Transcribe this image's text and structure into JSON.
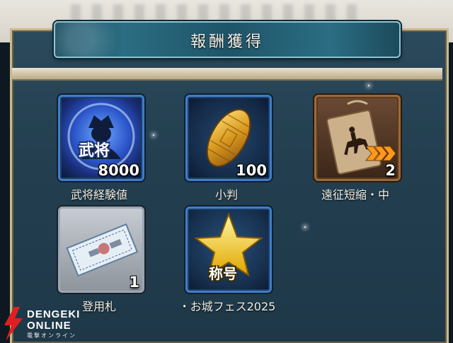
{
  "dialog": {
    "title": "報酬獲得"
  },
  "rewards": [
    {
      "label": "武将経験値",
      "quantity": "8000",
      "badge": "武将",
      "icon": "general-exp-orb-icon"
    },
    {
      "label": "小判",
      "quantity": "100",
      "icon": "koban-gold-coin-icon"
    },
    {
      "label": "遠征短縮・中",
      "quantity": "2",
      "icon": "expedition-shorten-plaque-icon"
    },
    {
      "label": "登用札",
      "quantity": "1",
      "icon": "recruit-ticket-icon"
    },
    {
      "label": "・お城フェス2025",
      "badge": "称号",
      "icon": "title-star-icon"
    }
  ],
  "watermark": {
    "line1": "DENGEKI",
    "line2": "ONLINE",
    "line3": "電撃オンライン"
  },
  "colors": {
    "panel": "#233f50",
    "banner": "#1f5468",
    "frame_blue": "#3f7ec8",
    "frame_bronze": "#9a6a3a",
    "frame_silver": "#9aa7b4"
  }
}
